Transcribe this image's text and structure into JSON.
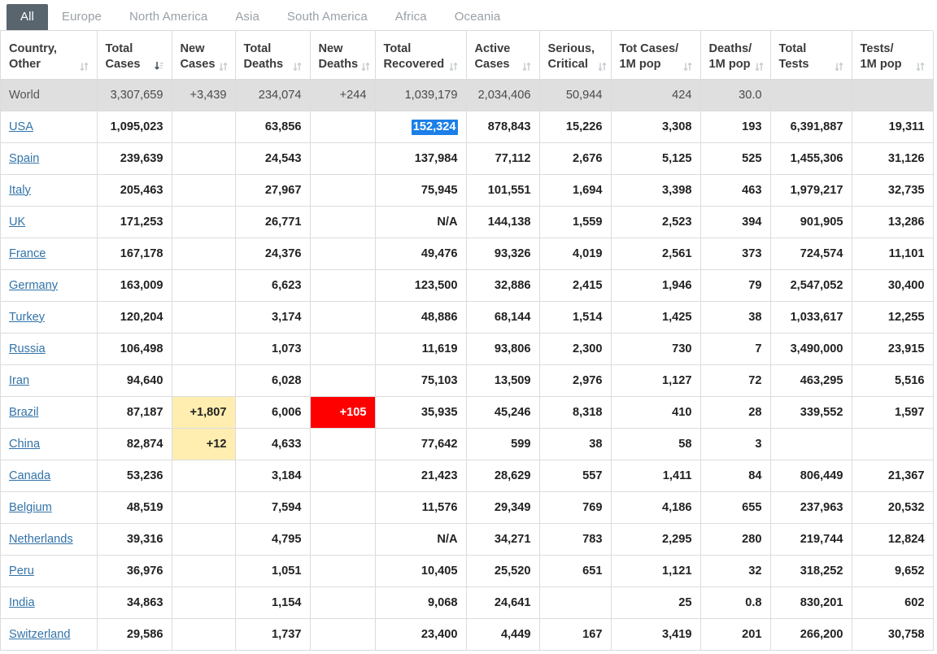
{
  "tabs": [
    {
      "label": "All",
      "active": true
    },
    {
      "label": "Europe",
      "active": false
    },
    {
      "label": "North America",
      "active": false
    },
    {
      "label": "Asia",
      "active": false
    },
    {
      "label": "South America",
      "active": false
    },
    {
      "label": "Africa",
      "active": false
    },
    {
      "label": "Oceania",
      "active": false
    }
  ],
  "columns": [
    {
      "id": "country",
      "line1": "Country,",
      "line2": "Other",
      "sort": "none"
    },
    {
      "id": "total_cases",
      "line1": "Total",
      "line2": "Cases",
      "sort": "desc"
    },
    {
      "id": "new_cases",
      "line1": "New",
      "line2": "Cases",
      "sort": "none"
    },
    {
      "id": "total_deaths",
      "line1": "Total",
      "line2": "Deaths",
      "sort": "none"
    },
    {
      "id": "new_deaths",
      "line1": "New",
      "line2": "Deaths",
      "sort": "none"
    },
    {
      "id": "total_recovered",
      "line1": "Total",
      "line2": "Recovered",
      "sort": "none"
    },
    {
      "id": "active_cases",
      "line1": "Active",
      "line2": "Cases",
      "sort": "none"
    },
    {
      "id": "serious",
      "line1": "Serious,",
      "line2": "Critical",
      "sort": "none"
    },
    {
      "id": "cases_per_1m",
      "line1": "Tot Cases/",
      "line2": "1M pop",
      "sort": "none"
    },
    {
      "id": "deaths_per_1m",
      "line1": "Deaths/",
      "line2": "1M pop",
      "sort": "none"
    },
    {
      "id": "total_tests",
      "line1": "Total",
      "line2": "Tests",
      "sort": "none"
    },
    {
      "id": "tests_per_1m",
      "line1": "Tests/",
      "line2": "1M pop",
      "sort": "none"
    }
  ],
  "rows": [
    {
      "country": "World",
      "is_world": true,
      "link": false,
      "total_cases": "3,307,659",
      "new_cases": "+3,439",
      "total_deaths": "234,074",
      "new_deaths": "+244",
      "total_recovered": "1,039,179",
      "active_cases": "2,034,406",
      "serious": "50,944",
      "cases_per_1m": "424",
      "deaths_per_1m": "30.0",
      "total_tests": "",
      "tests_per_1m": ""
    },
    {
      "country": "USA",
      "link": true,
      "total_cases": "1,095,023",
      "new_cases": "",
      "total_deaths": "63,856",
      "new_deaths": "",
      "total_recovered": "152,324",
      "total_recovered_selected": true,
      "active_cases": "878,843",
      "serious": "15,226",
      "cases_per_1m": "3,308",
      "deaths_per_1m": "193",
      "total_tests": "6,391,887",
      "tests_per_1m": "19,311"
    },
    {
      "country": "Spain",
      "link": true,
      "total_cases": "239,639",
      "new_cases": "",
      "total_deaths": "24,543",
      "new_deaths": "",
      "total_recovered": "137,984",
      "active_cases": "77,112",
      "serious": "2,676",
      "cases_per_1m": "5,125",
      "deaths_per_1m": "525",
      "total_tests": "1,455,306",
      "tests_per_1m": "31,126"
    },
    {
      "country": "Italy",
      "link": true,
      "total_cases": "205,463",
      "new_cases": "",
      "total_deaths": "27,967",
      "new_deaths": "",
      "total_recovered": "75,945",
      "active_cases": "101,551",
      "serious": "1,694",
      "cases_per_1m": "3,398",
      "deaths_per_1m": "463",
      "total_tests": "1,979,217",
      "tests_per_1m": "32,735"
    },
    {
      "country": "UK",
      "link": true,
      "total_cases": "171,253",
      "new_cases": "",
      "total_deaths": "26,771",
      "new_deaths": "",
      "total_recovered": "N/A",
      "active_cases": "144,138",
      "serious": "1,559",
      "cases_per_1m": "2,523",
      "deaths_per_1m": "394",
      "total_tests": "901,905",
      "tests_per_1m": "13,286"
    },
    {
      "country": "France",
      "link": true,
      "total_cases": "167,178",
      "new_cases": "",
      "total_deaths": "24,376",
      "new_deaths": "",
      "total_recovered": "49,476",
      "active_cases": "93,326",
      "serious": "4,019",
      "cases_per_1m": "2,561",
      "deaths_per_1m": "373",
      "total_tests": "724,574",
      "tests_per_1m": "11,101"
    },
    {
      "country": "Germany",
      "link": true,
      "total_cases": "163,009",
      "new_cases": "",
      "total_deaths": "6,623",
      "new_deaths": "",
      "total_recovered": "123,500",
      "active_cases": "32,886",
      "serious": "2,415",
      "cases_per_1m": "1,946",
      "deaths_per_1m": "79",
      "total_tests": "2,547,052",
      "tests_per_1m": "30,400"
    },
    {
      "country": "Turkey",
      "link": true,
      "total_cases": "120,204",
      "new_cases": "",
      "total_deaths": "3,174",
      "new_deaths": "",
      "total_recovered": "48,886",
      "active_cases": "68,144",
      "serious": "1,514",
      "cases_per_1m": "1,425",
      "deaths_per_1m": "38",
      "total_tests": "1,033,617",
      "tests_per_1m": "12,255"
    },
    {
      "country": "Russia",
      "link": true,
      "total_cases": "106,498",
      "new_cases": "",
      "total_deaths": "1,073",
      "new_deaths": "",
      "total_recovered": "11,619",
      "active_cases": "93,806",
      "serious": "2,300",
      "cases_per_1m": "730",
      "deaths_per_1m": "7",
      "total_tests": "3,490,000",
      "tests_per_1m": "23,915"
    },
    {
      "country": "Iran",
      "link": true,
      "total_cases": "94,640",
      "new_cases": "",
      "total_deaths": "6,028",
      "new_deaths": "",
      "total_recovered": "75,103",
      "active_cases": "13,509",
      "serious": "2,976",
      "cases_per_1m": "1,127",
      "deaths_per_1m": "72",
      "total_tests": "463,295",
      "tests_per_1m": "5,516"
    },
    {
      "country": "Brazil",
      "link": true,
      "total_cases": "87,187",
      "new_cases": "+1,807",
      "new_cases_highlight": true,
      "total_deaths": "6,006",
      "new_deaths": "+105",
      "new_deaths_highlight": true,
      "total_recovered": "35,935",
      "active_cases": "45,246",
      "serious": "8,318",
      "cases_per_1m": "410",
      "deaths_per_1m": "28",
      "total_tests": "339,552",
      "tests_per_1m": "1,597"
    },
    {
      "country": "China",
      "link": true,
      "total_cases": "82,874",
      "new_cases": "+12",
      "new_cases_highlight": true,
      "total_deaths": "4,633",
      "new_deaths": "",
      "total_recovered": "77,642",
      "active_cases": "599",
      "serious": "38",
      "cases_per_1m": "58",
      "deaths_per_1m": "3",
      "total_tests": "",
      "tests_per_1m": ""
    },
    {
      "country": "Canada",
      "link": true,
      "total_cases": "53,236",
      "new_cases": "",
      "total_deaths": "3,184",
      "new_deaths": "",
      "total_recovered": "21,423",
      "active_cases": "28,629",
      "serious": "557",
      "cases_per_1m": "1,411",
      "deaths_per_1m": "84",
      "total_tests": "806,449",
      "tests_per_1m": "21,367"
    },
    {
      "country": "Belgium",
      "link": true,
      "total_cases": "48,519",
      "new_cases": "",
      "total_deaths": "7,594",
      "new_deaths": "",
      "total_recovered": "11,576",
      "active_cases": "29,349",
      "serious": "769",
      "cases_per_1m": "4,186",
      "deaths_per_1m": "655",
      "total_tests": "237,963",
      "tests_per_1m": "20,532"
    },
    {
      "country": "Netherlands",
      "link": true,
      "total_cases": "39,316",
      "new_cases": "",
      "total_deaths": "4,795",
      "new_deaths": "",
      "total_recovered": "N/A",
      "active_cases": "34,271",
      "serious": "783",
      "cases_per_1m": "2,295",
      "deaths_per_1m": "280",
      "total_tests": "219,744",
      "tests_per_1m": "12,824"
    },
    {
      "country": "Peru",
      "link": true,
      "total_cases": "36,976",
      "new_cases": "",
      "total_deaths": "1,051",
      "new_deaths": "",
      "total_recovered": "10,405",
      "active_cases": "25,520",
      "serious": "651",
      "cases_per_1m": "1,121",
      "deaths_per_1m": "32",
      "total_tests": "318,252",
      "tests_per_1m": "9,652"
    },
    {
      "country": "India",
      "link": true,
      "total_cases": "34,863",
      "new_cases": "",
      "total_deaths": "1,154",
      "new_deaths": "",
      "total_recovered": "9,068",
      "active_cases": "24,641",
      "serious": "",
      "cases_per_1m": "25",
      "deaths_per_1m": "0.8",
      "total_tests": "830,201",
      "tests_per_1m": "602"
    },
    {
      "country": "Switzerland",
      "link": true,
      "total_cases": "29,586",
      "new_cases": "",
      "total_deaths": "1,737",
      "new_deaths": "",
      "total_recovered": "23,400",
      "active_cases": "4,449",
      "serious": "167",
      "cases_per_1m": "3,419",
      "deaths_per_1m": "201",
      "total_tests": "266,200",
      "tests_per_1m": "30,758"
    }
  ],
  "colors": {
    "active_tab_bg": "#58646e",
    "new_cases_highlight": "#ffeeb0",
    "new_deaths_highlight": "#ff0000",
    "selection_blue": "#1c7fe8",
    "link": "#3273a8",
    "world_row_bg": "#dfdfdf"
  }
}
